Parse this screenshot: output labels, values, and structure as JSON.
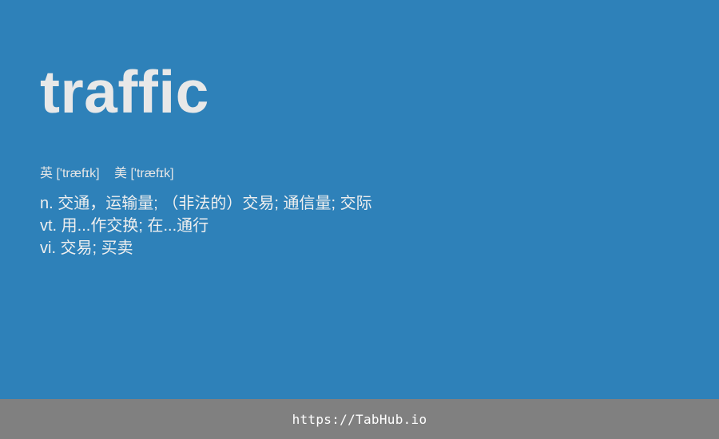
{
  "entry": {
    "word": "traffic",
    "phonetics": [
      {
        "label": "英",
        "ipa": "['træfɪk]"
      },
      {
        "label": "美",
        "ipa": "['træfɪk]"
      }
    ],
    "definitions": [
      "n. 交通，运输量; （非法的）交易; 通信量; 交际",
      "vt. 用...作交换; 在...通行",
      "vi. 交易; 买卖"
    ]
  },
  "footer": {
    "link_text": "https://TabHub.io"
  },
  "colors": {
    "background": "#2e81b9",
    "footer_background": "#808080",
    "text": "#ececec"
  }
}
